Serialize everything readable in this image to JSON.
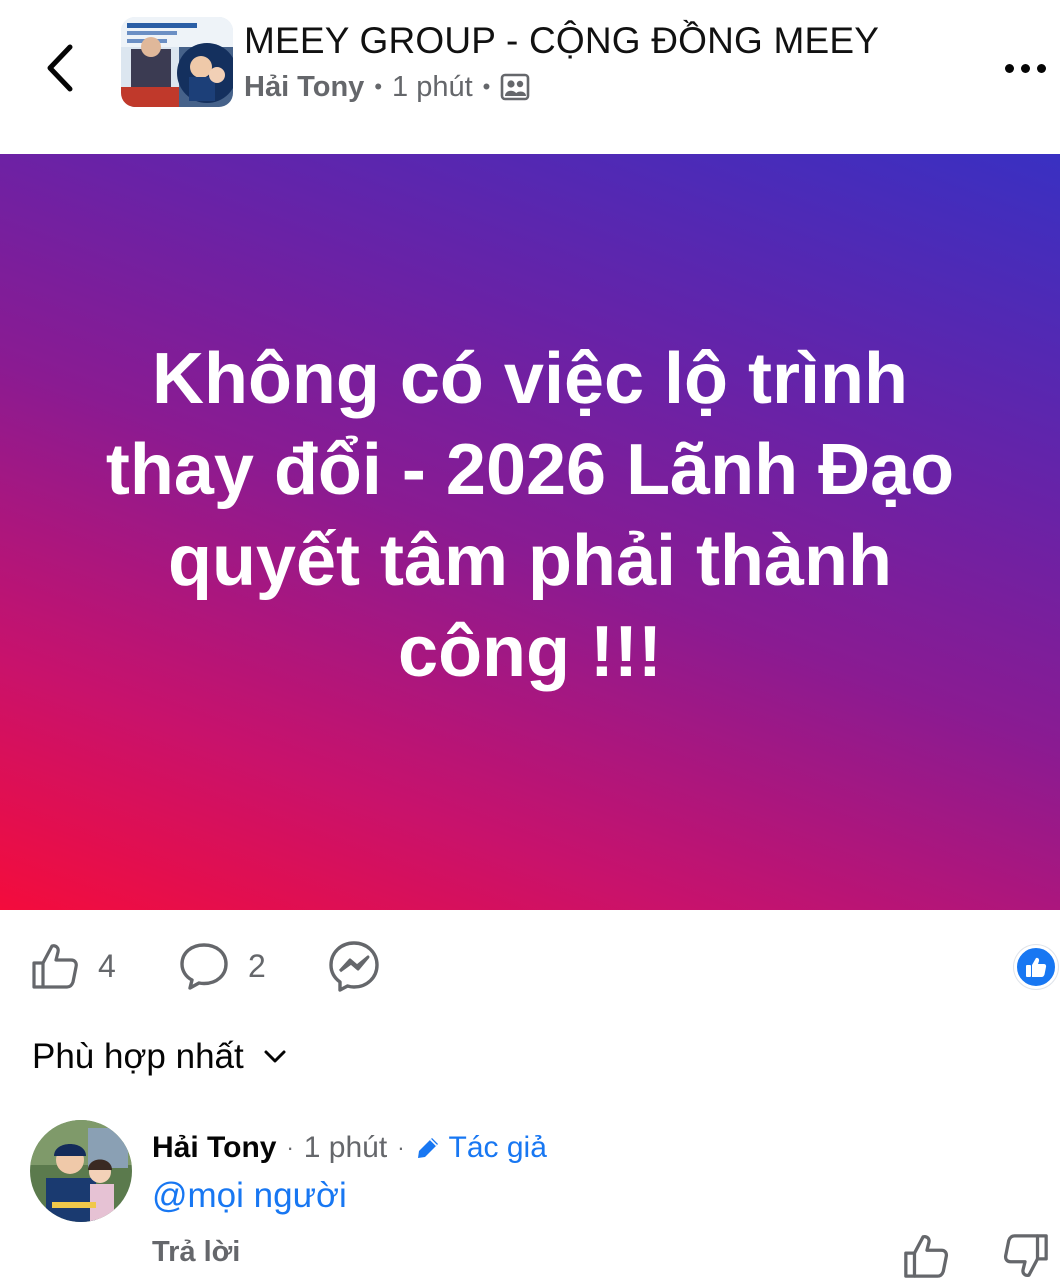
{
  "header": {
    "group_name": "MEEY GROUP - CỘNG ĐỒNG MEEY",
    "author": "Hải Tony",
    "time": "1 phút",
    "privacy_icon": "group-members-icon"
  },
  "post": {
    "text": "Không có việc lộ trình thay đổi - 2026 Lãnh Đạo quyết tâm phải thành công !!!",
    "gradient_colors": [
      "#f40c3c",
      "#c8126c",
      "#8a1b92",
      "#6a22a6",
      "#3930c2"
    ]
  },
  "actions": {
    "like_count": "4",
    "comment_count": "2"
  },
  "sort": {
    "label": "Phù hợp nhất"
  },
  "comment": {
    "name": "Hải Tony",
    "time": "1 phút",
    "badge": "Tác giả",
    "text": "@mọi người",
    "reply_label": "Trả lời"
  },
  "colors": {
    "accent": "#1877f2",
    "muted": "#65676b"
  }
}
